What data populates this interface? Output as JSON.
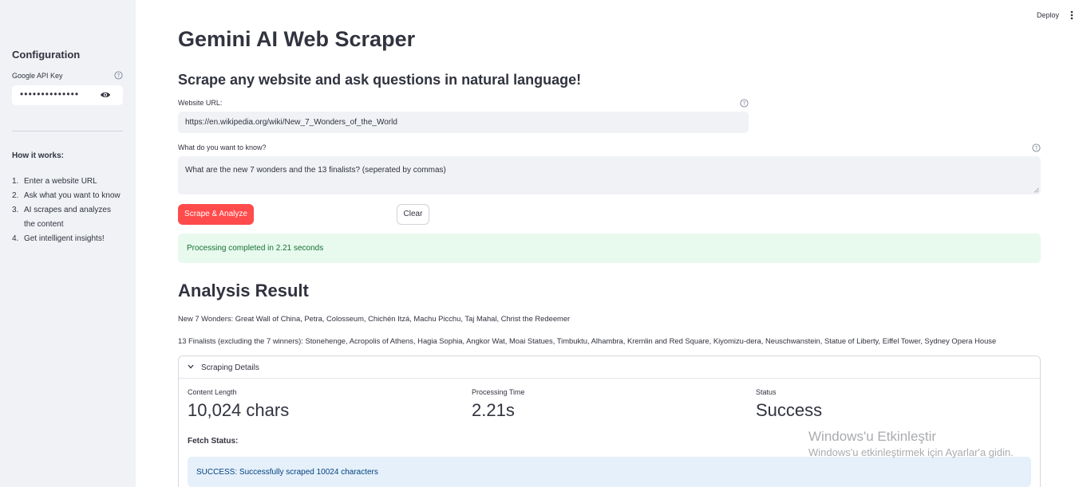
{
  "sidebar": {
    "title": "Configuration",
    "api_key_label": "Google API Key",
    "api_key_masked": "••••••••••••••",
    "how_title": "How it works:",
    "steps": [
      {
        "num": "1.",
        "text": "Enter a website URL"
      },
      {
        "num": "2.",
        "text": "Ask what you want to know"
      },
      {
        "num": "3.",
        "text": "AI scrapes and analyzes the content"
      },
      {
        "num": "4.",
        "text": "Get intelligent insights!"
      }
    ]
  },
  "toolbar": {
    "deploy_label": "Deploy"
  },
  "main": {
    "title": "Gemini AI Web Scraper",
    "subtitle": "Scrape any website and ask questions in natural language!",
    "url_label": "Website URL:",
    "url_value": "https://en.wikipedia.org/wiki/New_7_Wonders_of_the_World",
    "question_label": "What do you want to know?",
    "question_value": "What are the new 7 wonders and the 13 finalists? (seperated by commas)",
    "scrape_button": "Scrape & Analyze",
    "clear_button": "Clear",
    "success_message": "Processing completed in 2.21 seconds",
    "result_title": "Analysis Result",
    "result_line1": "New 7 Wonders: Great Wall of China, Petra, Colosseum, Chichén Itzá, Machu Picchu, Taj Mahal, Christ the Redeemer",
    "result_line2": "13 Finalists (excluding the 7 winners): Stonehenge, Acropolis of Athens, Hagia Sophia, Angkor Wat, Moai Statues, Timbuktu, Alhambra, Kremlin and Red Square, Kiyomizu-dera, Neuschwanstein, Statue of Liberty, Eiffel Tower, Sydney Opera House",
    "details": {
      "title": "Scraping Details",
      "metrics": [
        {
          "label": "Content Length",
          "value": "10,024 chars"
        },
        {
          "label": "Processing Time",
          "value": "2.21s"
        },
        {
          "label": "Status",
          "value": "Success"
        }
      ],
      "fetch_title": "Fetch Status:",
      "fetch_message": "SUCCESS: Successfully scraped 10024 characters"
    }
  },
  "watermark": {
    "line1": "Windows'u Etkinleştir",
    "line2": "Windows'u etkinleştirmek için Ayarlar'a gidin."
  }
}
